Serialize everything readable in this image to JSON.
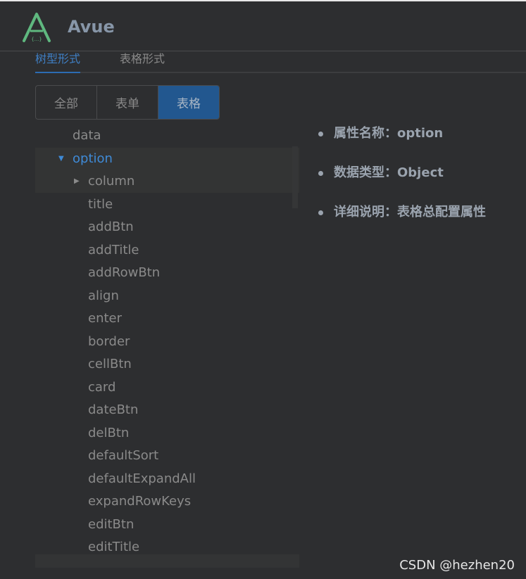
{
  "header": {
    "brand": "Avue",
    "logo_text": "{...}"
  },
  "tabs": [
    {
      "label": "树型形式",
      "active": true
    },
    {
      "label": "表格形式",
      "active": false
    }
  ],
  "segments": [
    {
      "label": "全部"
    },
    {
      "label": "表单"
    },
    {
      "label": "表格",
      "active": true
    }
  ],
  "tree": {
    "items": [
      {
        "label": "data",
        "level": 0
      },
      {
        "label": "option",
        "level": 0,
        "expanded": true,
        "selected": true
      },
      {
        "label": "column",
        "level": 1,
        "expandable": true
      },
      {
        "label": "title",
        "level": 1
      },
      {
        "label": "addBtn",
        "level": 1
      },
      {
        "label": "addTitle",
        "level": 1
      },
      {
        "label": "addRowBtn",
        "level": 1
      },
      {
        "label": "align",
        "level": 1
      },
      {
        "label": "enter",
        "level": 1
      },
      {
        "label": "border",
        "level": 1
      },
      {
        "label": "cellBtn",
        "level": 1
      },
      {
        "label": "card",
        "level": 1
      },
      {
        "label": "dateBtn",
        "level": 1
      },
      {
        "label": "delBtn",
        "level": 1
      },
      {
        "label": "defaultSort",
        "level": 1
      },
      {
        "label": "defaultExpandAll",
        "level": 1
      },
      {
        "label": "expandRowKeys",
        "level": 1
      },
      {
        "label": "editBtn",
        "level": 1
      },
      {
        "label": "editTitle",
        "level": 1
      }
    ]
  },
  "details": [
    {
      "text": "属性名称：option"
    },
    {
      "text": "数据类型：Object"
    },
    {
      "text": "详细说明：表格总配置属性"
    }
  ],
  "watermark": "CSDN @hezhen20",
  "colors": {
    "accent": "#3f8ad6",
    "active_segment": "#22578f",
    "logo": "#5fb87f"
  }
}
